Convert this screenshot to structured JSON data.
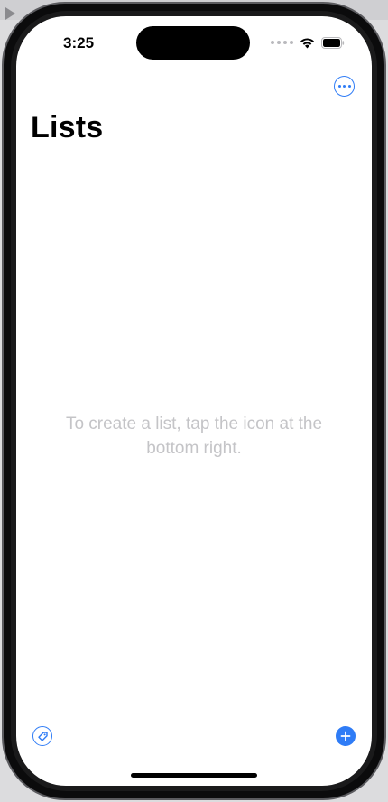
{
  "status_bar": {
    "time": "3:25"
  },
  "navigation": {
    "title": "Lists",
    "more_icon": "ellipsis-circle-icon"
  },
  "content": {
    "empty_message": "To create a list, tap the icon at the bottom right."
  },
  "toolbar": {
    "tag_icon": "tag-icon",
    "add_icon": "plus-circle-fill-icon"
  },
  "colors": {
    "accent": "#2f7cf6",
    "empty_text": "#c4c4c7"
  }
}
